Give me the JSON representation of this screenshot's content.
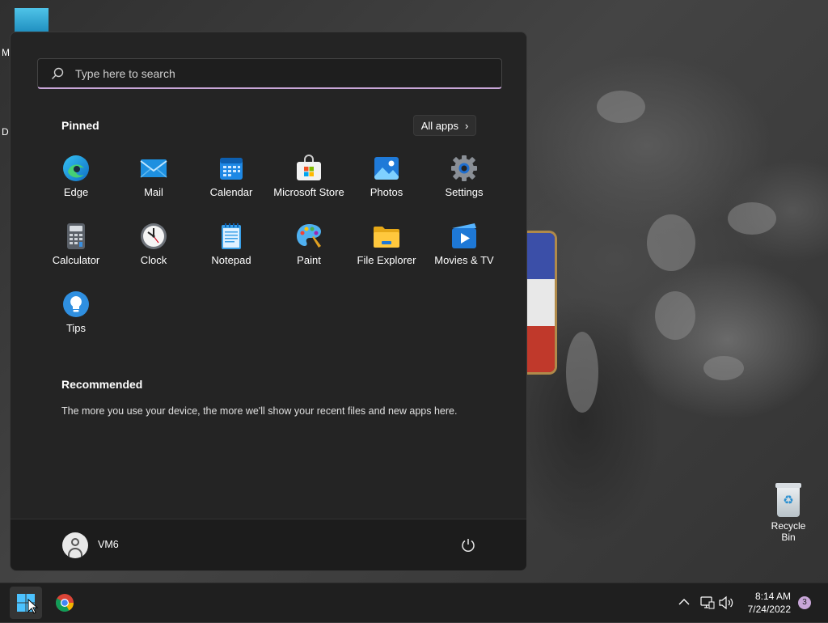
{
  "desktop": {
    "partial_labels": [
      "M",
      "D"
    ],
    "recycle_bin_label": "Recycle Bin"
  },
  "start_menu": {
    "search": {
      "placeholder": "Type here to search"
    },
    "pinned_title": "Pinned",
    "all_apps_label": "All apps",
    "pinned_apps": [
      {
        "label": "Edge",
        "icon": "edge-icon"
      },
      {
        "label": "Mail",
        "icon": "mail-icon"
      },
      {
        "label": "Calendar",
        "icon": "calendar-icon"
      },
      {
        "label": "Microsoft Store",
        "icon": "store-icon"
      },
      {
        "label": "Photos",
        "icon": "photos-icon"
      },
      {
        "label": "Settings",
        "icon": "gear-icon"
      },
      {
        "label": "Calculator",
        "icon": "calculator-icon"
      },
      {
        "label": "Clock",
        "icon": "clock-icon"
      },
      {
        "label": "Notepad",
        "icon": "notepad-icon"
      },
      {
        "label": "Paint",
        "icon": "paint-palette-icon"
      },
      {
        "label": "File Explorer",
        "icon": "folder-icon"
      },
      {
        "label": "Movies & TV",
        "icon": "film-play-icon"
      },
      {
        "label": "Tips",
        "icon": "lightbulb-icon"
      }
    ],
    "recommended_title": "Recommended",
    "recommended_text": "The more you use your device, the more we'll show your recent files and new apps here.",
    "user_name": "VM6"
  },
  "taskbar": {
    "time": "8:14 AM",
    "date": "7/24/2022",
    "notification_count": "3"
  },
  "colors": {
    "accent": "#c8a6d8",
    "menu_bg": "#242424",
    "taskbar_bg": "#1f1f1f"
  }
}
